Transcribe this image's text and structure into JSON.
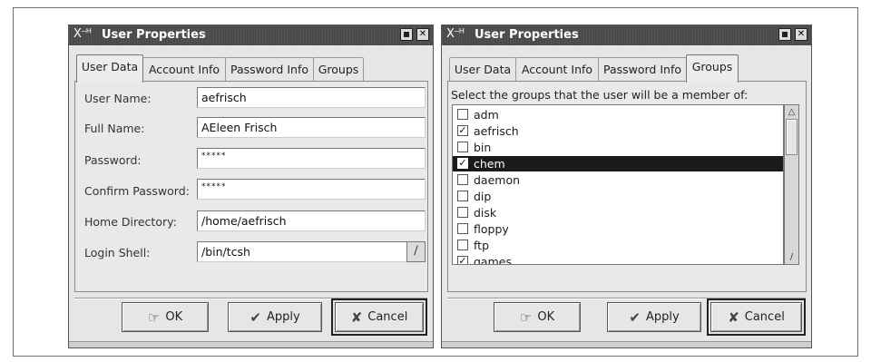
{
  "left_window": {
    "title": "User Properties",
    "tabs": [
      {
        "label": "User Data",
        "active": true
      },
      {
        "label": "Account Info",
        "active": false
      },
      {
        "label": "Password Info",
        "active": false
      },
      {
        "label": "Groups",
        "active": false
      }
    ],
    "fields": {
      "user_name": {
        "label": "User Name:",
        "value": "aefrisch"
      },
      "full_name": {
        "label": "Full Name:",
        "value": "AEleen Frisch"
      },
      "password": {
        "label": "Password:",
        "value": "*****"
      },
      "confirm_password": {
        "label": "Confirm Password:",
        "value": "*****"
      },
      "home_directory": {
        "label": "Home Directory:",
        "value": "/home/aefrisch"
      },
      "login_shell": {
        "label": "Login Shell:",
        "value": "/bin/tcsh"
      }
    },
    "buttons": {
      "ok": "OK",
      "apply": "Apply",
      "cancel": "Cancel"
    }
  },
  "right_window": {
    "title": "User Properties",
    "tabs": [
      {
        "label": "User Data",
        "active": false
      },
      {
        "label": "Account Info",
        "active": false
      },
      {
        "label": "Password Info",
        "active": false
      },
      {
        "label": "Groups",
        "active": true
      }
    ],
    "instruction": "Select the groups that the user will be a member of:",
    "groups": [
      {
        "name": "adm",
        "checked": false,
        "selected": false
      },
      {
        "name": "aefrisch",
        "checked": true,
        "selected": false
      },
      {
        "name": "bin",
        "checked": false,
        "selected": false
      },
      {
        "name": "chem",
        "checked": true,
        "selected": true
      },
      {
        "name": "daemon",
        "checked": false,
        "selected": false
      },
      {
        "name": "dip",
        "checked": false,
        "selected": false
      },
      {
        "name": "disk",
        "checked": false,
        "selected": false
      },
      {
        "name": "floppy",
        "checked": false,
        "selected": false
      },
      {
        "name": "ftp",
        "checked": false,
        "selected": false
      },
      {
        "name": "games",
        "checked": true,
        "selected": false
      }
    ],
    "buttons": {
      "ok": "OK",
      "apply": "Apply",
      "cancel": "Cancel"
    }
  }
}
